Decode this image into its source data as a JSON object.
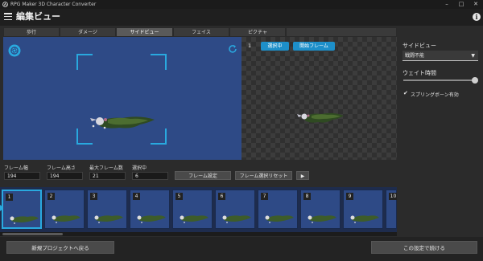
{
  "window": {
    "title": "RPG Maker 3D Character Converter",
    "minimize_glyph": "–",
    "maximize_glyph": "□",
    "close_glyph": "✕"
  },
  "header": {
    "menu_icon": "hamburger-menu-icon",
    "title": "編集ビュー",
    "info_icon": "info-icon",
    "info_glyph": "i"
  },
  "tabs": [
    {
      "label": "歩行",
      "active": false
    },
    {
      "label": "ダメージ",
      "active": false
    },
    {
      "label": "サイドビュー",
      "active": true
    },
    {
      "label": "フェイス",
      "active": false
    },
    {
      "label": "ピクチャ",
      "active": false
    }
  ],
  "preview": {
    "camera_icon": "aperture-icon",
    "refresh_icon": "refresh-icon",
    "frame_index": "1",
    "selected_button": "選択中",
    "start_frame_button": "開始フレーム"
  },
  "controls": {
    "frame_width_label": "フレーム幅",
    "frame_width_value": "194",
    "frame_height_label": "フレーム高さ",
    "frame_height_value": "194",
    "max_frames_label": "最大フレーム数",
    "max_frames_value": "21",
    "selecting_label": "選択中",
    "selecting_value": "6",
    "frame_settings_button": "フレーム設定",
    "frame_reset_button": "フレーム選択リセット",
    "play_glyph": "▶"
  },
  "frames": [
    {
      "num": "1",
      "selected": true
    },
    {
      "num": "2",
      "selected": false
    },
    {
      "num": "3",
      "selected": false
    },
    {
      "num": "4",
      "selected": false
    },
    {
      "num": "5",
      "selected": false
    },
    {
      "num": "6",
      "selected": false
    },
    {
      "num": "7",
      "selected": false
    },
    {
      "num": "8",
      "selected": false
    },
    {
      "num": "9",
      "selected": false
    },
    {
      "num": "10",
      "selected": false
    }
  ],
  "sidebar": {
    "section_title": "サイドビュー",
    "select_value": "戦闘不能",
    "select_arrow": "▼",
    "wait_label": "ウェイト時間",
    "wait_value": 1.0,
    "checkbox_glyph": "✔",
    "spring_bone_label": "スプリングボーン有効",
    "spring_bone_checked": true
  },
  "footer": {
    "back_button": "新規プロジェクトへ戻る",
    "continue_button": "この設定で続ける"
  },
  "colors": {
    "accent": "#29a9df",
    "button_blue": "#1d8fc9",
    "preview_bg": "#2e4a86",
    "panel_bg": "#2b2b2b"
  }
}
